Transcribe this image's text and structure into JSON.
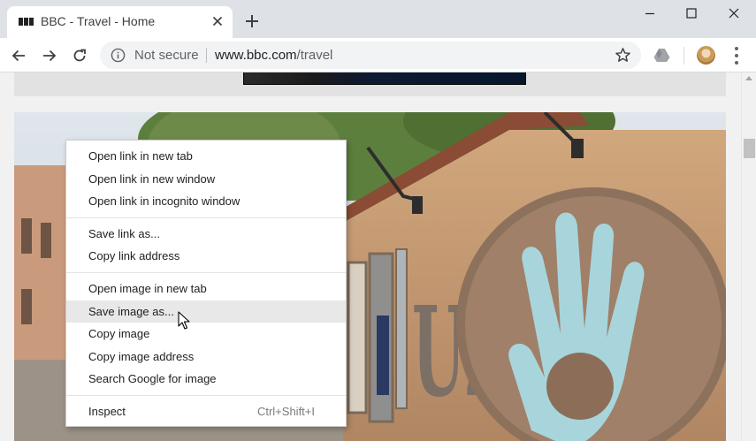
{
  "tab": {
    "title": "BBC - Travel - Home"
  },
  "window_controls": [
    "minimize",
    "maximize",
    "close"
  ],
  "addressbar": {
    "security_label": "Not secure",
    "url_host": "www.bbc.com",
    "url_path": "/travel"
  },
  "icons": {
    "favicon": "bbc-logo-icon",
    "tab_close": "close-icon",
    "new_tab": "plus-icon",
    "back": "arrow-left-icon",
    "forward": "arrow-right-icon",
    "reload": "reload-icon",
    "info": "info-icon",
    "bookmark": "star-icon",
    "extension": "google-drive-icon",
    "profile": "avatar",
    "menu": "three-dots-vertical-icon"
  },
  "context_menu": {
    "groups": [
      [
        "Open link in new tab",
        "Open link in new window",
        "Open link in incognito window"
      ],
      [
        "Save link as...",
        "Copy link address"
      ],
      [
        "Open image in new tab",
        "Save image as...",
        "Copy image",
        "Copy image address",
        "Search Google for image"
      ],
      [
        "Inspect"
      ]
    ],
    "hovered_item": "Save image as...",
    "inspect_shortcut": "Ctrl+Shift+I"
  },
  "hero_sign": {
    "letters": "UŽ"
  }
}
